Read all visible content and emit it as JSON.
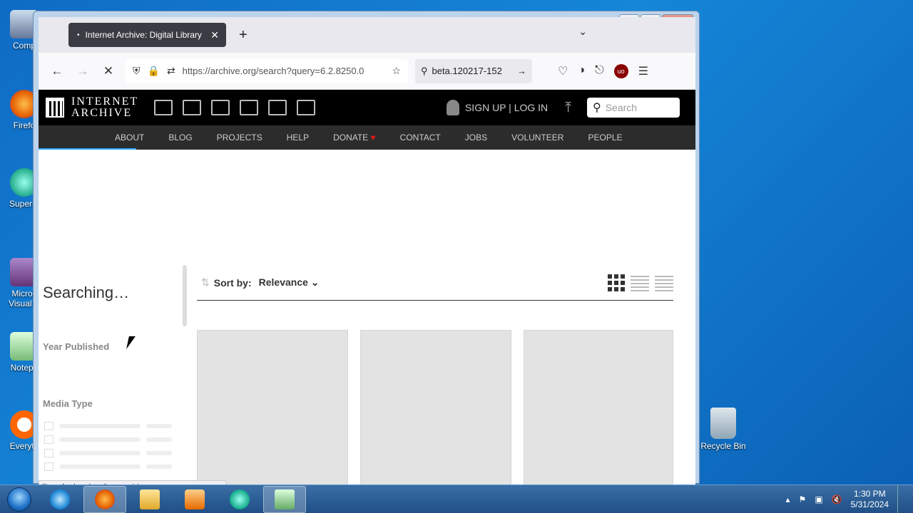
{
  "desktop": {
    "icons": [
      {
        "label": "Comp",
        "icon": "computer-icon"
      },
      {
        "label": "Firefo",
        "icon": "firefox-icon"
      },
      {
        "label": "Superm",
        "icon": "app-icon"
      },
      {
        "label": "Micros Visual S",
        "icon": "visual-studio-icon"
      },
      {
        "label": "Notepa",
        "icon": "notepad-icon"
      },
      {
        "label": "Everyth",
        "icon": "search-app-icon"
      }
    ],
    "recycle_bin": "Recycle Bin"
  },
  "browser": {
    "tab_title": "Internet Archive: Digital Library",
    "url": "https://archive.org/search?query=6.2.8250.0",
    "search_text": "beta.120217-152"
  },
  "ia": {
    "logo_line1": "INTERNET",
    "logo_line2": "ARCHIVE",
    "signup": "SIGN UP | LOG IN",
    "search_placeholder": "Search",
    "nav": [
      "ABOUT",
      "BLOG",
      "PROJECTS",
      "HELP",
      "DONATE",
      "CONTACT",
      "JOBS",
      "VOLUNTEER",
      "PEOPLE"
    ]
  },
  "results": {
    "status_heading": "Searching…",
    "facets": [
      "Year Published",
      "Media Type"
    ],
    "sort_label": "Sort by:",
    "sort_value": "Relevance"
  },
  "status_bar": "Transferring data from archive.org...",
  "taskbar": {
    "time": "1:30 PM",
    "date": "5/31/2024"
  },
  "colors": {
    "desktop_blue": "#1586d8",
    "ia_header": "#000000",
    "ia_nav": "#2c2c2c",
    "donate_heart": "#e01b1b"
  }
}
